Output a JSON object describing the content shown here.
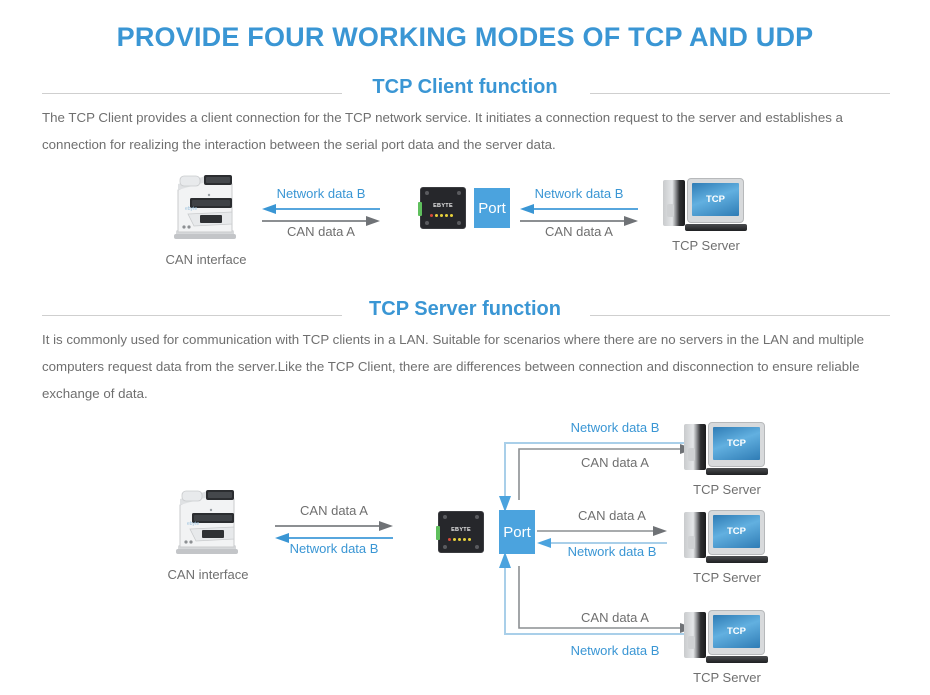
{
  "page": {
    "title": "PROVIDE FOUR WORKING MODES OF TCP AND UDP",
    "accent_blue": "#3a96d4",
    "port_blue": "#4ba3de",
    "body_gray": "#6f6f6f",
    "rule_gray": "#cfcfcf"
  },
  "sections": [
    {
      "heading": "TCP Client function",
      "paragraph": "The TCP Client provides a client connection for the TCP network service. It initiates a connection request to the server and establishes a connection for realizing the interaction between the serial port data and the server data."
    },
    {
      "heading": "TCP Server function",
      "paragraph": "It is commonly used for communication with TCP clients in a LAN. Suitable for scenarios where there are no servers in the LAN and multiple computers request data from the server.Like the TCP Client, there are differences between connection and disconnection to ensure reliable exchange of data."
    }
  ],
  "labels": {
    "can_interface": "CAN interface",
    "tcp_server": "TCP Server",
    "port": "Port",
    "network_data_b": "Network data B",
    "can_data_a": "CAN data A",
    "ebyte_logo": "EBYTE",
    "screen_text": "TCP"
  },
  "diagram_client": {
    "left_pair": {
      "top_caption": "Network data B",
      "bottom_caption": "CAN data A"
    },
    "right_pair": {
      "top_caption": "Network data B",
      "bottom_caption": "CAN data A"
    }
  },
  "diagram_server": {
    "left_pair": {
      "top_caption": "CAN data A",
      "bottom_caption": "Network data B"
    },
    "branches": [
      {
        "top_caption": "Network data B",
        "bottom_caption": "CAN data A",
        "server_label": "TCP Server"
      },
      {
        "top_caption": "CAN data A",
        "bottom_caption": "Network data B",
        "server_label": "TCP Server"
      },
      {
        "top_caption": "CAN data A",
        "bottom_caption": "Network data B",
        "server_label": "TCP Server"
      }
    ]
  }
}
